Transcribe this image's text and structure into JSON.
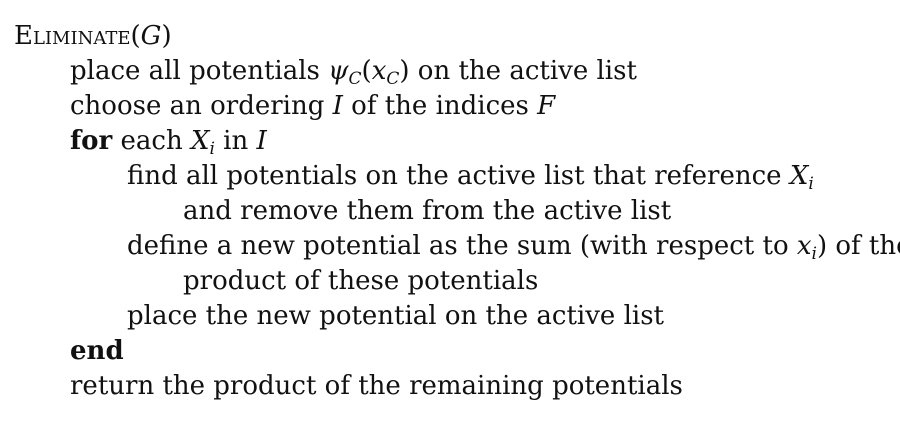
{
  "algorithm": {
    "name": "Eliminate",
    "arg": "G",
    "lines": [
      {
        "pre": "place all potentials ",
        "psi": "ψ",
        "psi_sub": "C",
        "x": "x",
        "x_sub": "C",
        "post": " on the active list"
      },
      {
        "pre": "choose an ordering ",
        "I": "I",
        "mid": " of the indices ",
        "F": "F"
      },
      {
        "kw": "for",
        "mid": " each ",
        "X": "X",
        "X_sub": "i",
        "post": " in ",
        "I": "I"
      },
      {
        "pre": "find all potentials on the active list that reference ",
        "X": "X",
        "X_sub": "i"
      },
      {
        "text": "and remove them from the active list"
      },
      {
        "pre": "define a new potential as the sum (with respect to ",
        "x": "x",
        "x_sub": "i",
        "post": ") of the"
      },
      {
        "text": "product of these potentials"
      },
      {
        "text": "place the new potential on the active list"
      },
      {
        "kw": "end"
      },
      {
        "text": "return the product of the remaining potentials"
      }
    ]
  }
}
